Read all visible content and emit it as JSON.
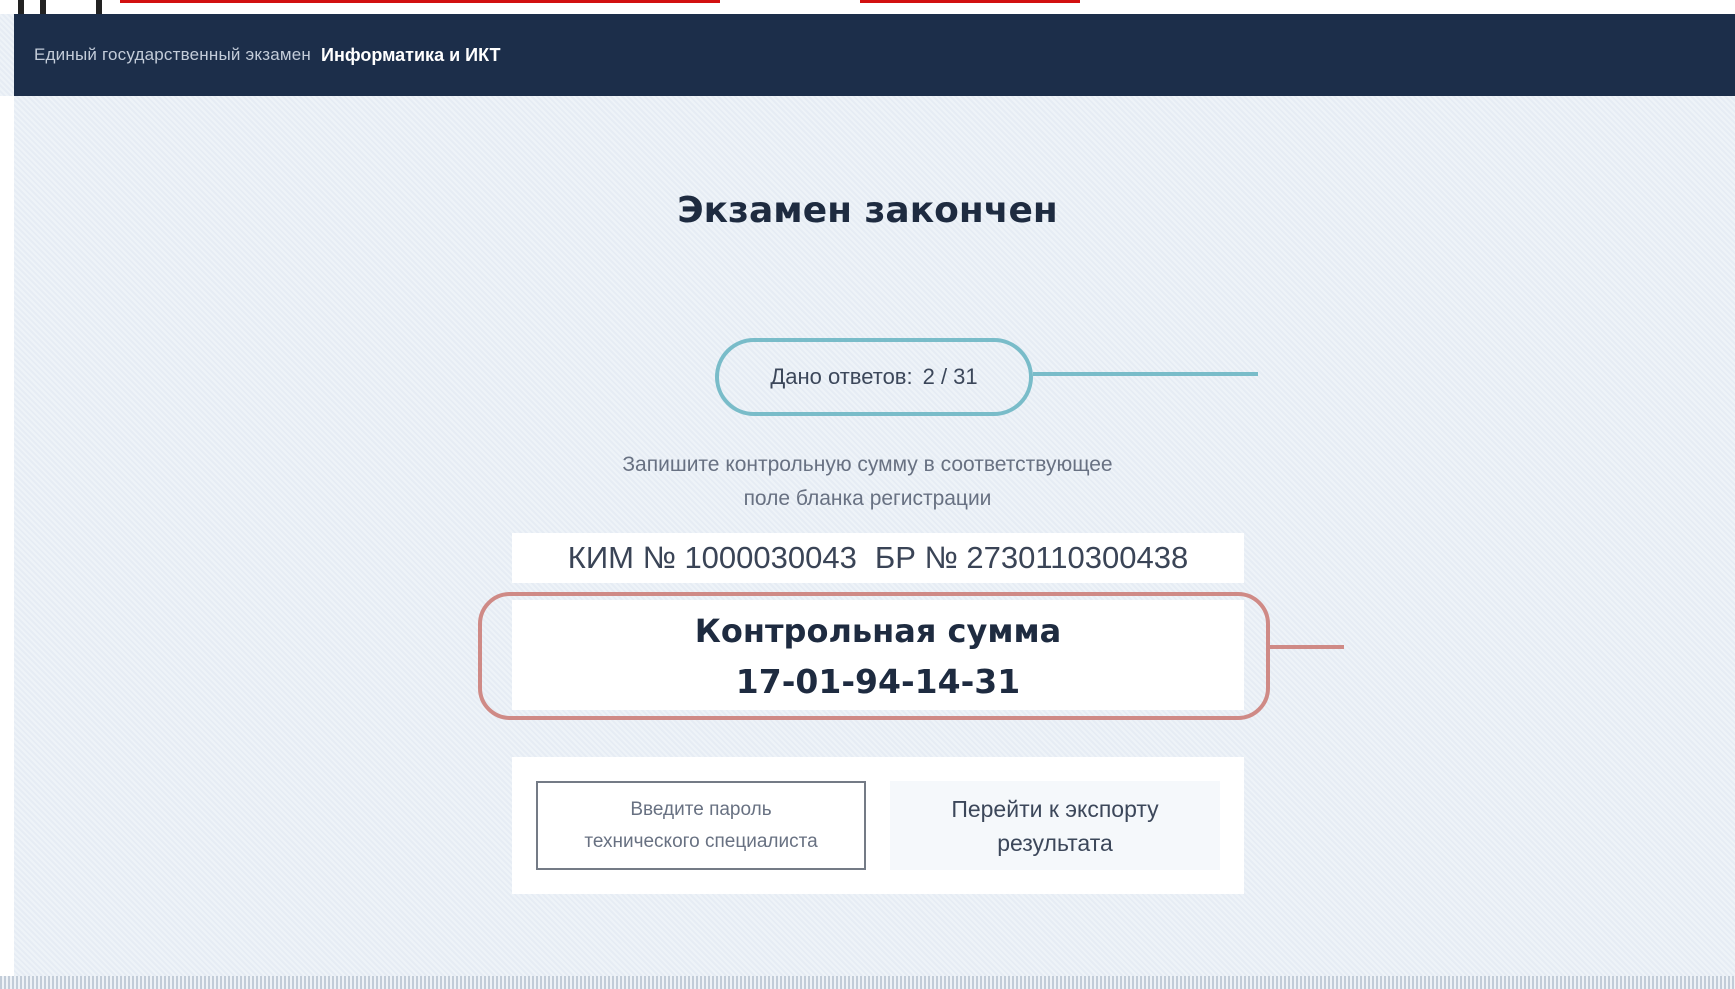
{
  "header": {
    "subtitle": "Единый государственный экзамен",
    "subject": "Информатика и ИКТ"
  },
  "main": {
    "title": "Экзамен закончен",
    "answers_label": "Дано ответов:",
    "answers_value": "2 / 31",
    "instruction_line1": "Запишите контрольную сумму в соответствующее",
    "instruction_line2": "поле бланка регистрации",
    "kim": "КИМ № 1000030043",
    "br": "БР № 2730110300438",
    "checksum_title": "Контрольная сумма",
    "checksum_value": "17-01-94-14-31"
  },
  "actions": {
    "password_line1": "Введите пароль",
    "password_line2": "технического специалиста",
    "export_line1": "Перейти к экспорту",
    "export_line2": "результата"
  },
  "colors": {
    "header_bg": "#1c2e4a",
    "answers_highlight": "#79bcc9",
    "checksum_highlight": "#cf8a86"
  }
}
